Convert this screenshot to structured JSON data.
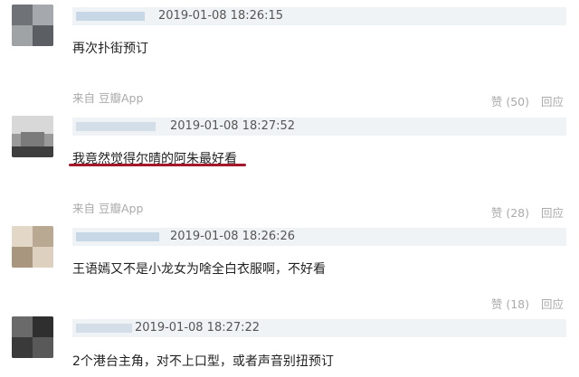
{
  "comments": [
    {
      "date": "2019-01-08 18:26:15",
      "text": "再次扑街预订",
      "source": "来自 豆瓣App",
      "like_label": "赞 (50)",
      "reply_label": "回应"
    },
    {
      "date": "2019-01-08 18:27:52",
      "text": "我竟然觉得尔晴的阿朱最好看",
      "source": "来自 豆瓣App",
      "like_label": "赞 (28)",
      "reply_label": "回应"
    },
    {
      "date": "2019-01-08 18:26:26",
      "text": "王语嫣又不是小龙女为啥全白衣服啊，不好看",
      "source": "",
      "like_label": "赞 (18)",
      "reply_label": "回应"
    },
    {
      "date": "2019-01-08 18:27:22",
      "text": "2个港台主角，对不上口型，或者声音别扭预订",
      "source": "",
      "like_label": "",
      "reply_label": ""
    }
  ]
}
